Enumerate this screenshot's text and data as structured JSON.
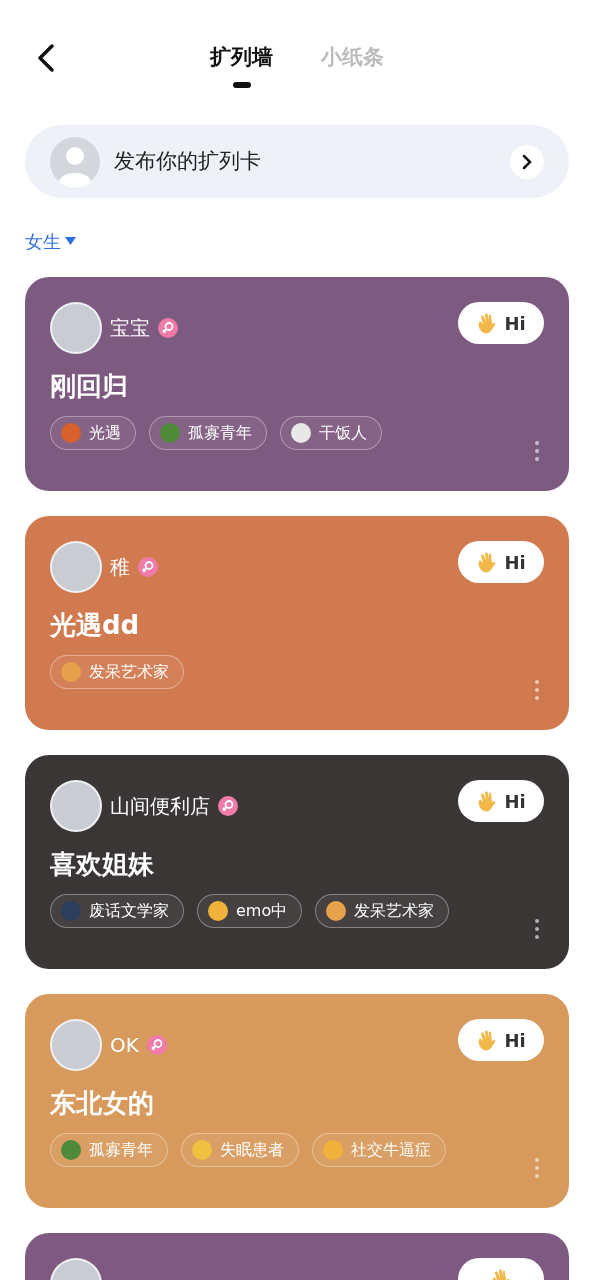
{
  "tabs": [
    {
      "label": "扩列墙",
      "selected": true
    },
    {
      "label": "小纸条",
      "selected": false
    }
  ],
  "publish": {
    "label": "发布你的扩列卡"
  },
  "filter": {
    "label": "女生"
  },
  "cards": [
    {
      "name": "宝宝",
      "title": "刚回归",
      "hi_label": "Hi",
      "color": "#7d5a80",
      "tags": [
        {
          "label": "光遇",
          "color": "#d8602c"
        },
        {
          "label": "孤寡青年",
          "color": "#4f8a3a"
        },
        {
          "label": "干饭人",
          "color": "#e8e8e8"
        }
      ]
    },
    {
      "name": "稚",
      "title": "光遇dd",
      "hi_label": "Hi",
      "color": "#d27a4f",
      "tags": [
        {
          "label": "发呆艺术家",
          "color": "#e6a14a"
        }
      ]
    },
    {
      "name": "山间便利店",
      "title": "喜欢姐妹",
      "hi_label": "Hi",
      "color": "#3a3636",
      "tags": [
        {
          "label": "废话文学家",
          "color": "#2c3e5c"
        },
        {
          "label": "emo中",
          "color": "#f0b23a"
        },
        {
          "label": "发呆艺术家",
          "color": "#e6a14a"
        }
      ]
    },
    {
      "name": "OK",
      "title": "东北女的",
      "hi_label": "Hi",
      "color": "#d79a5c",
      "tags": [
        {
          "label": "孤寡青年",
          "color": "#4f8a3a"
        },
        {
          "label": "失眠患者",
          "color": "#f0c040"
        },
        {
          "label": "社交牛逼症",
          "color": "#f0b23a"
        }
      ]
    },
    {
      "color": "#7e5a82"
    }
  ]
}
